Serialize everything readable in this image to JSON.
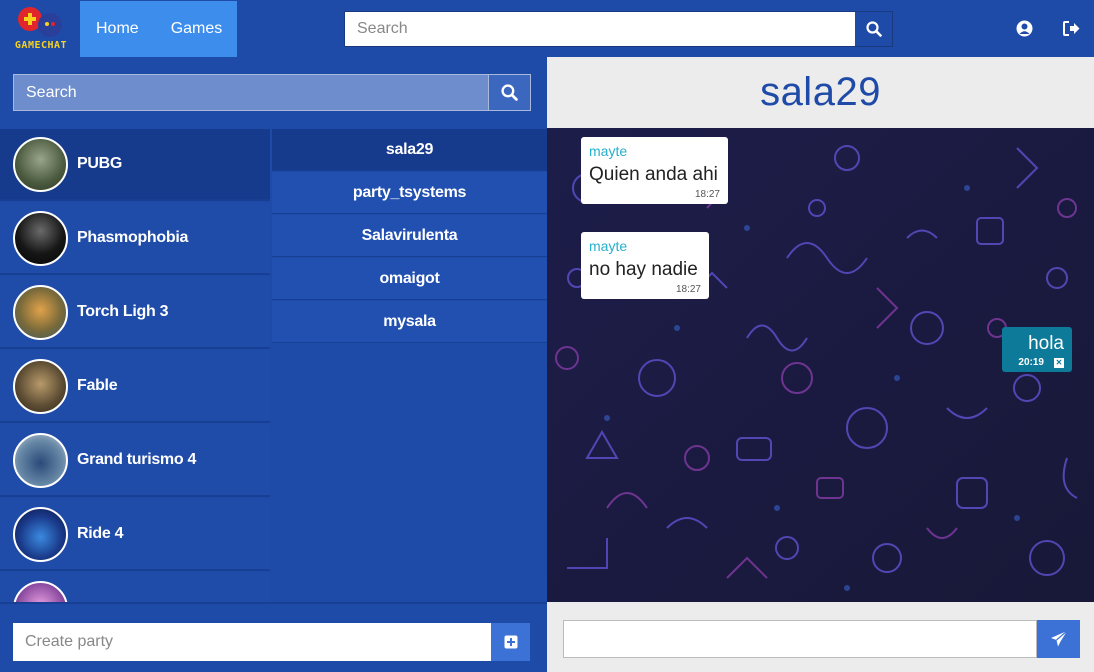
{
  "app": {
    "logo_text": "GAMECHAT",
    "nav": [
      {
        "label": "Home"
      },
      {
        "label": "Games"
      }
    ],
    "search_placeholder": "Search"
  },
  "sidebar": {
    "search_placeholder": "Search",
    "games": [
      {
        "name": "PUBG",
        "active": true,
        "color": "#6d7c5e"
      },
      {
        "name": "Phasmophobia",
        "active": false,
        "color": "#1a1a1a"
      },
      {
        "name": "Torch Ligh 3",
        "active": false,
        "color": "#b08a4a"
      },
      {
        "name": "Fable",
        "active": false,
        "color": "#6e5a3c"
      },
      {
        "name": "Grand turismo 4",
        "active": false,
        "color": "#4a6a88"
      },
      {
        "name": "Ride 4",
        "active": false,
        "color": "#1a2a60"
      },
      {
        "name": "",
        "active": false,
        "color": "#c58ac4"
      }
    ],
    "rooms": [
      {
        "name": "sala29",
        "active": true
      },
      {
        "name": "party_tsystems",
        "active": false
      },
      {
        "name": "Salavirulenta",
        "active": false
      },
      {
        "name": "omaigot",
        "active": false
      },
      {
        "name": "mysala",
        "active": false
      }
    ],
    "create_placeholder": "Create party"
  },
  "chat": {
    "room_title": "sala29",
    "messages": [
      {
        "user": "mayte",
        "text": "Quien anda ahi",
        "time": "18:27"
      },
      {
        "user": "mayte",
        "text": "no hay nadie",
        "time": "18:27"
      },
      {
        "user": "",
        "text": "hola",
        "time": "20:19",
        "mine": true
      }
    ],
    "input_placeholder": ""
  },
  "colors": {
    "primary": "#1e4aa8",
    "nav_active": "#3d8eec",
    "accent": "#3c72d6",
    "own_message": "#0e7a9a",
    "username": "#27b0cc"
  }
}
